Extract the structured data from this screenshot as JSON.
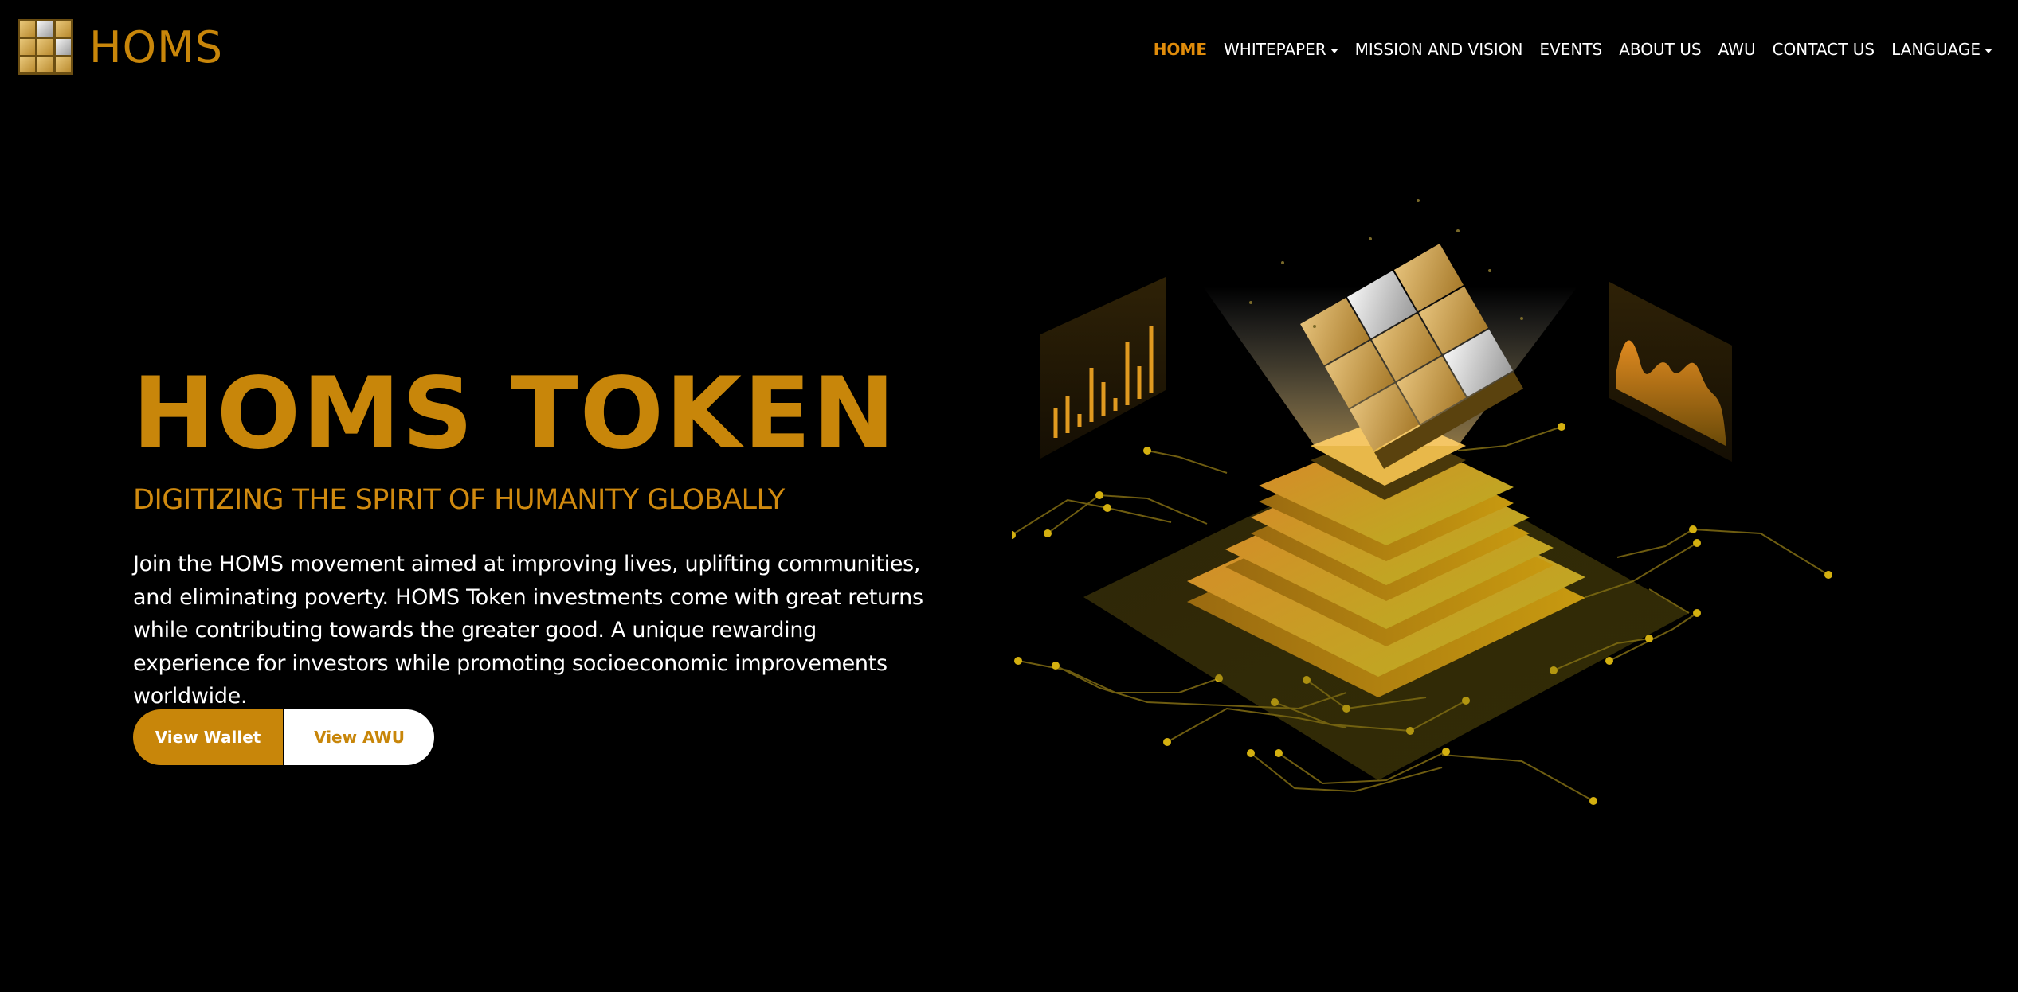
{
  "brand": {
    "name": "HOMS"
  },
  "nav": {
    "items": [
      {
        "label": "HOME",
        "active": true,
        "dropdown": false
      },
      {
        "label": "WHITEPAPER",
        "active": false,
        "dropdown": true
      },
      {
        "label": "MISSION AND VISION",
        "active": false,
        "dropdown": false
      },
      {
        "label": "EVENTS",
        "active": false,
        "dropdown": false
      },
      {
        "label": "ABOUT US",
        "active": false,
        "dropdown": false
      },
      {
        "label": "AWU",
        "active": false,
        "dropdown": false
      },
      {
        "label": "CONTACT US",
        "active": false,
        "dropdown": false
      },
      {
        "label": "LANGUAGE",
        "active": false,
        "dropdown": true
      }
    ]
  },
  "hero": {
    "title": "HOMS TOKEN",
    "subtitle": "DIGITIZING THE SPIRIT OF HUMANITY GLOBALLY",
    "description": "Join the HOMS movement aimed at improving lives, uplifting communities, and eliminating poverty. HOMS Token investments come with great returns while contributing towards the greater good. A unique rewarding experience for investors while promoting socioeconomic improvements worldwide.",
    "primary_button": "View Wallet",
    "secondary_button": "View AWU"
  },
  "colors": {
    "accent": "#c8860a",
    "nav_active": "#e08c0b",
    "background": "#000000",
    "text": "#ffffff"
  },
  "icons": {
    "logo": "gold-tile-grid-icon",
    "dropdown": "caret-down-icon",
    "illustration": "isometric-token-platform-illustration"
  }
}
